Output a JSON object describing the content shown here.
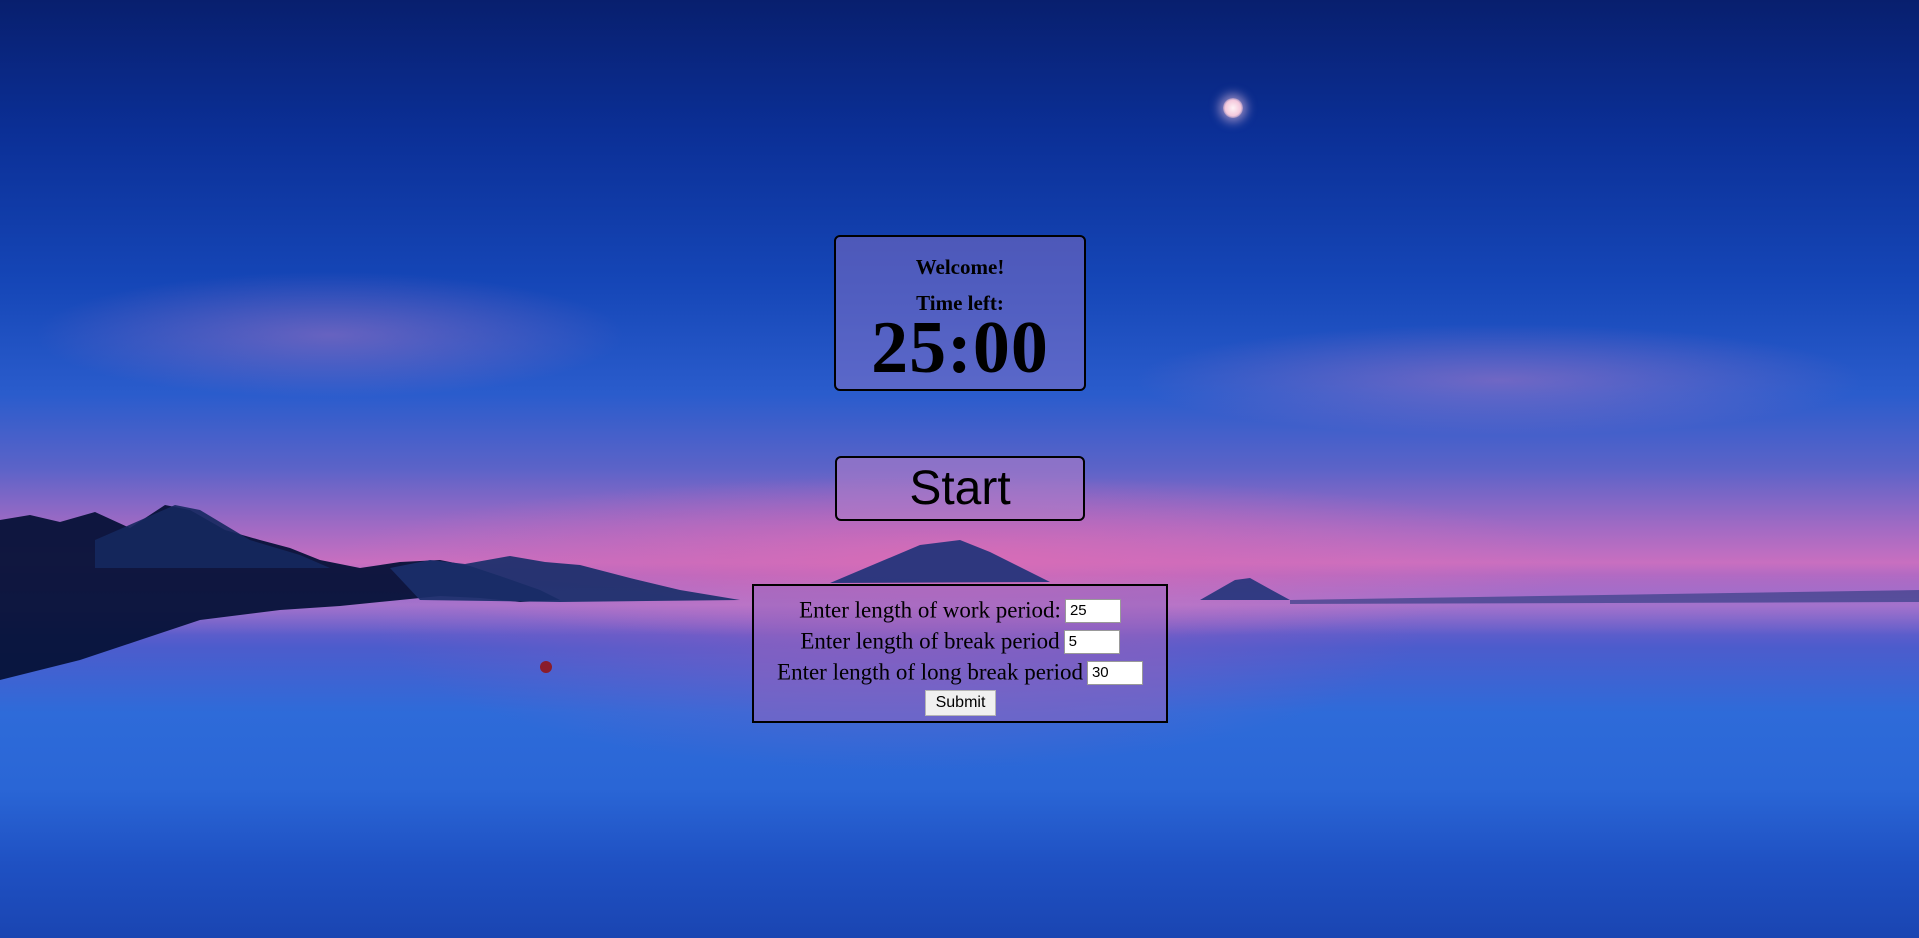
{
  "timer": {
    "welcome": "Welcome!",
    "time_left_label": "Time left:",
    "time_value": "25:00"
  },
  "controls": {
    "start_label": "Start"
  },
  "settings": {
    "work_label": "Enter length of work period:",
    "work_value": "25",
    "break_label": "Enter length of break period",
    "break_value": "5",
    "long_break_label": "Enter length of long break period",
    "long_break_value": "30",
    "submit_label": "Submit"
  }
}
